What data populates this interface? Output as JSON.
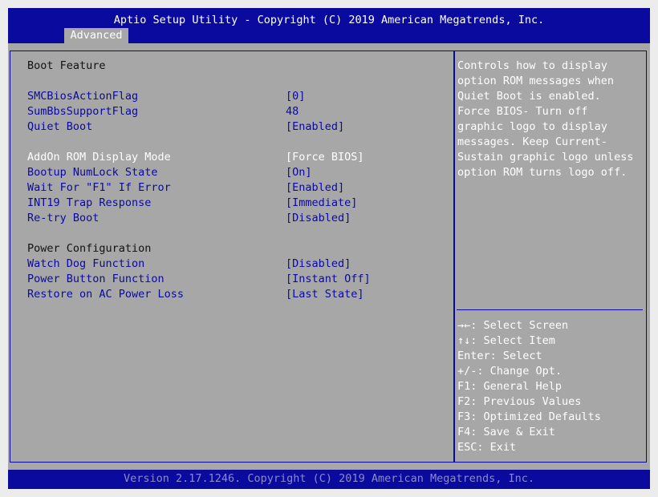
{
  "header": {
    "title": "Aptio Setup Utility - Copyright (C) 2019 American Megatrends, Inc.",
    "tabs": [
      {
        "label": "Advanced"
      }
    ]
  },
  "main": {
    "section_boot": "Boot Feature",
    "section_power": "Power Configuration",
    "items": [
      {
        "label": "SMCBiosActionFlag",
        "value": "[0]"
      },
      {
        "label": "SumBbsSupportFlag",
        "value": "48"
      },
      {
        "label": "Quiet Boot",
        "value": "[Enabled]"
      },
      {
        "label": "AddOn ROM Display Mode",
        "value": "[Force BIOS]"
      },
      {
        "label": "Bootup NumLock State",
        "value": "[On]"
      },
      {
        "label": "Wait For \"F1\" If Error",
        "value": "[Enabled]"
      },
      {
        "label": "INT19 Trap Response",
        "value": "[Immediate]"
      },
      {
        "label": "Re-try Boot",
        "value": "[Disabled]"
      },
      {
        "label": "Watch Dog Function",
        "value": "[Disabled]"
      },
      {
        "label": "Power Button Function",
        "value": "[Instant Off]"
      },
      {
        "label": "Restore on AC Power Loss",
        "value": "[Last State]"
      }
    ],
    "selected_item": "AddOn ROM Display Mode"
  },
  "help": {
    "text": "Controls how to display\noption ROM messages when\nQuiet Boot is enabled.\nForce BIOS- Turn off\ngraphic logo to display\nmessages. Keep Current-\nSustain graphic logo unless\noption ROM turns logo off.",
    "keys": [
      {
        "key": "→←",
        "desc": ": Select Screen"
      },
      {
        "key": "↑↓",
        "desc": ": Select Item"
      },
      {
        "key": "Enter",
        "desc": ": Select"
      },
      {
        "key": "+/-",
        "desc": ": Change Opt."
      },
      {
        "key": "F1",
        "desc": ": General Help"
      },
      {
        "key": "F2",
        "desc": ": Previous Values"
      },
      {
        "key": "F3",
        "desc": ": Optimized Defaults"
      },
      {
        "key": "F4",
        "desc": ": Save & Exit"
      },
      {
        "key": "ESC",
        "desc": ": Exit"
      }
    ]
  },
  "footer": {
    "version": "Version 2.17.1246. Copyright (C) 2019 American Megatrends, Inc."
  },
  "colors": {
    "bar_blue": "#0a0a9e",
    "panel_gray": "#a7a7a7",
    "item_blue": "#0a0a9e",
    "text_white": "#ffffff"
  }
}
